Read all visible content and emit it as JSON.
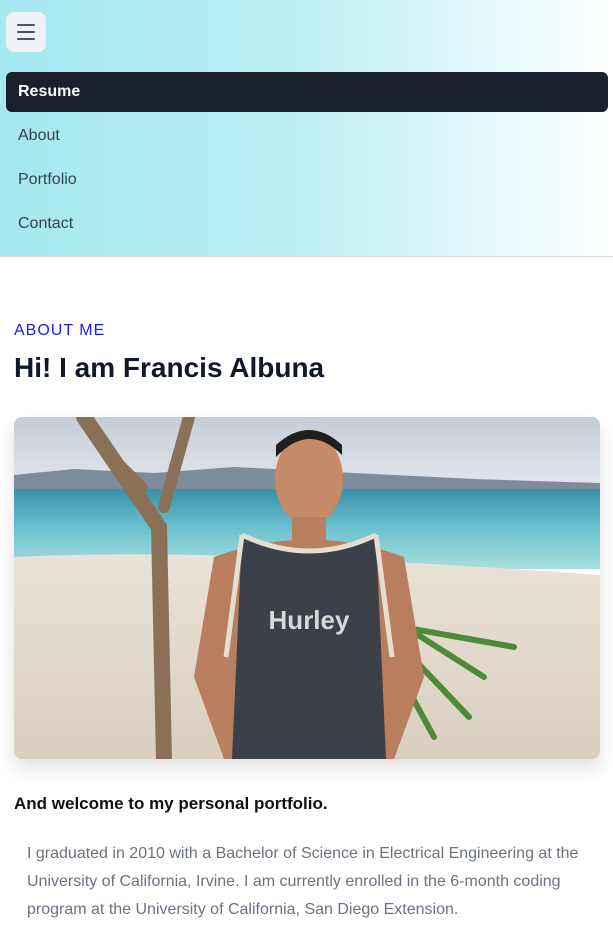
{
  "nav": {
    "menu_icon": "hamburger-icon",
    "items": [
      {
        "label": "Resume",
        "active": true
      },
      {
        "label": "About",
        "active": false
      },
      {
        "label": "Portfolio",
        "active": false
      },
      {
        "label": "Contact",
        "active": false
      }
    ]
  },
  "hero": {
    "eyebrow": "ABOUT ME",
    "title": "Hi! I am Francis Albuna",
    "photo_shirt_text": "Hurley"
  },
  "content": {
    "welcome": "And welcome to my personal portfolio.",
    "intro": "I graduated in 2010 with a Bachelor of Science in Electrical Engineering at the University of California, Irvine. I am currently enrolled in the 6-month coding program at the University of California, San Diego Extension."
  },
  "colors": {
    "accent": "#1d1fd8",
    "nav_active_bg": "#1a202c",
    "header_gradient_start": "#a5e8f0"
  }
}
